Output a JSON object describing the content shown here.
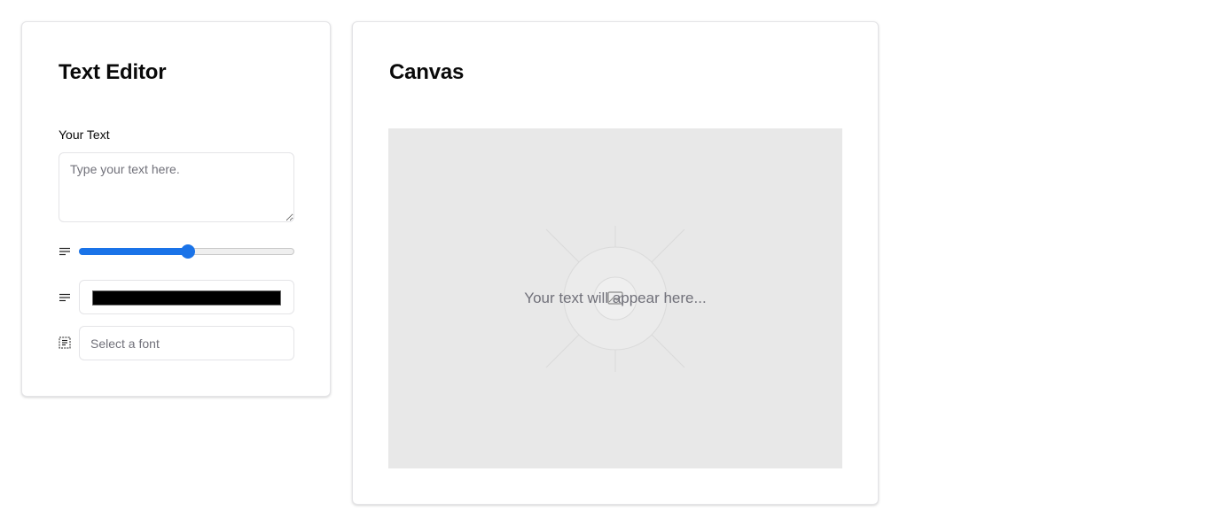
{
  "editor": {
    "title": "Text Editor",
    "text_label": "Your Text",
    "text_value": "",
    "text_placeholder": "Type your text here.",
    "size_icon": "align-left-icon",
    "size_slider_fraction": 0.5,
    "color_icon": "align-left-icon",
    "color_value": "#000000",
    "font_icon": "text-frame-icon",
    "font_value": "",
    "font_placeholder": "Select a font"
  },
  "canvas": {
    "title": "Canvas",
    "placeholder_text": "Your text will appear here...",
    "background_color": "#e8e8e8",
    "center_icon": "image-icon"
  },
  "colors": {
    "accent": "#1a73e8",
    "border": "#e4e4e7",
    "muted_text": "#71717a"
  }
}
